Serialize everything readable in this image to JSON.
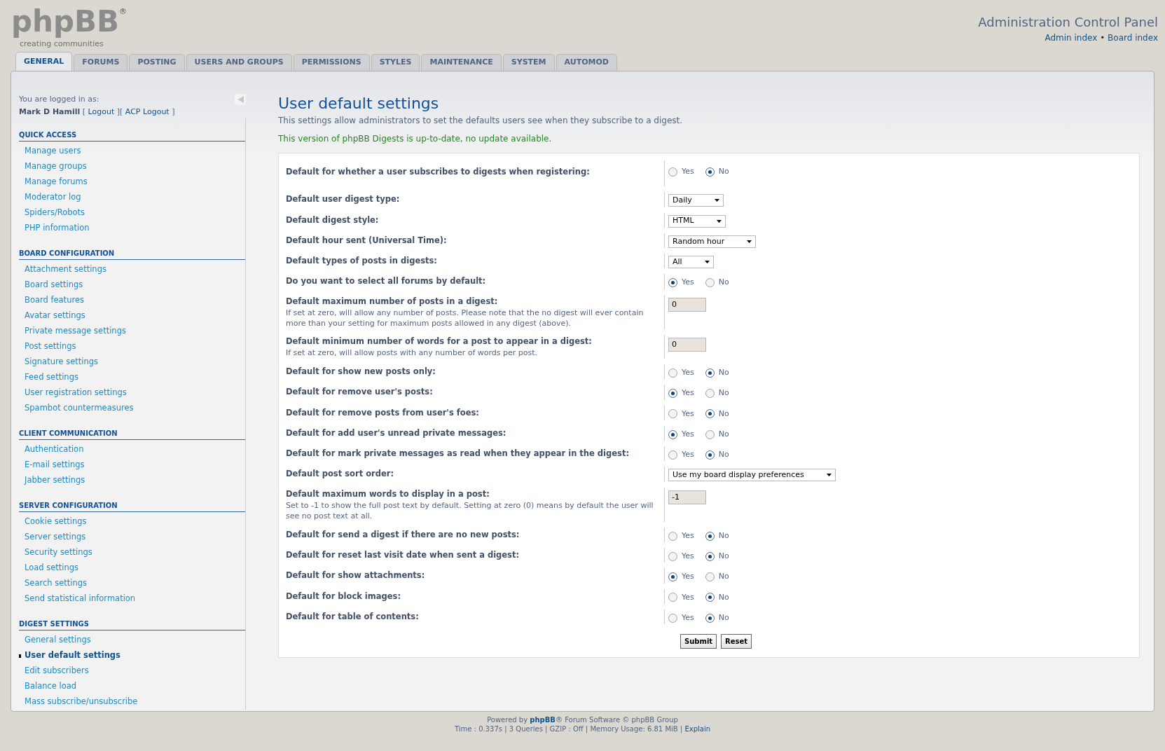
{
  "logo": {
    "text": "phpBB",
    "mark": "®",
    "tagline": "creating communities"
  },
  "header": {
    "title": "Administration Control Panel",
    "links": [
      {
        "kind": "link",
        "text": "Admin index"
      },
      {
        "kind": "text",
        "text": " • "
      },
      {
        "kind": "link",
        "text": "Board index"
      }
    ]
  },
  "tabs": [
    {
      "label": "GENERAL",
      "selected": true
    },
    {
      "label": "FORUMS",
      "selected": false
    },
    {
      "label": "POSTING",
      "selected": false
    },
    {
      "label": "USERS AND GROUPS",
      "selected": false
    },
    {
      "label": "PERMISSIONS",
      "selected": false
    },
    {
      "label": "STYLES",
      "selected": false
    },
    {
      "label": "MAINTENANCE",
      "selected": false
    },
    {
      "label": "SYSTEM",
      "selected": false
    },
    {
      "label": "AUTOMOD",
      "selected": false
    }
  ],
  "sidebar": {
    "login_label": "You are logged in as:",
    "login_line": [
      {
        "kind": "user",
        "text": "Mark D Hamill"
      },
      {
        "kind": "text",
        "text": " [ "
      },
      {
        "kind": "link",
        "text": "Logout"
      },
      {
        "kind": "text",
        "text": " ][ "
      },
      {
        "kind": "link",
        "text": "ACP Logout"
      },
      {
        "kind": "text",
        "text": " ]"
      }
    ],
    "sections": [
      {
        "title": "QUICK ACCESS",
        "items": [
          {
            "label": "Manage users",
            "selected": false
          },
          {
            "label": "Manage groups",
            "selected": false
          },
          {
            "label": "Manage forums",
            "selected": false
          },
          {
            "label": "Moderator log",
            "selected": false
          },
          {
            "label": "Spiders/Robots",
            "selected": false
          },
          {
            "label": "PHP information",
            "selected": false
          }
        ]
      },
      {
        "title": "BOARD CONFIGURATION",
        "items": [
          {
            "label": "Attachment settings",
            "selected": false
          },
          {
            "label": "Board settings",
            "selected": false
          },
          {
            "label": "Board features",
            "selected": false
          },
          {
            "label": "Avatar settings",
            "selected": false
          },
          {
            "label": "Private message settings",
            "selected": false
          },
          {
            "label": "Post settings",
            "selected": false
          },
          {
            "label": "Signature settings",
            "selected": false
          },
          {
            "label": "Feed settings",
            "selected": false
          },
          {
            "label": "User registration settings",
            "selected": false
          },
          {
            "label": "Spambot countermeasures",
            "selected": false
          }
        ]
      },
      {
        "title": "CLIENT COMMUNICATION",
        "items": [
          {
            "label": "Authentication",
            "selected": false
          },
          {
            "label": "E-mail settings",
            "selected": false
          },
          {
            "label": "Jabber settings",
            "selected": false
          }
        ]
      },
      {
        "title": "SERVER CONFIGURATION",
        "items": [
          {
            "label": "Cookie settings",
            "selected": false
          },
          {
            "label": "Server settings",
            "selected": false
          },
          {
            "label": "Security settings",
            "selected": false
          },
          {
            "label": "Load settings",
            "selected": false
          },
          {
            "label": "Search settings",
            "selected": false
          },
          {
            "label": "Send statistical information",
            "selected": false
          }
        ]
      },
      {
        "title": "DIGEST SETTINGS",
        "items": [
          {
            "label": "General settings",
            "selected": false
          },
          {
            "label": "User default settings",
            "selected": true
          },
          {
            "label": "Edit subscribers",
            "selected": false
          },
          {
            "label": "Balance load",
            "selected": false
          },
          {
            "label": "Mass subscribe/unsubscribe",
            "selected": false
          }
        ]
      }
    ]
  },
  "page": {
    "title": "User default settings",
    "description": "This settings allow administrators to set the defaults users see when they subscribe to a digest.",
    "notice": "This version of phpBB Digests is up-to-date, no update available."
  },
  "form": {
    "rows": [
      {
        "kind": "radio",
        "label": "Default for whether a user subscribes to digests when registering:",
        "options": [
          {
            "label": "Yes",
            "selected": false
          },
          {
            "label": "No",
            "selected": true
          }
        ]
      },
      {
        "kind": "select",
        "label": "Default user digest type:",
        "value": "Daily"
      },
      {
        "kind": "select",
        "label": "Default digest style:",
        "value": "HTML"
      },
      {
        "kind": "select",
        "label": "Default hour sent (Universal Time):",
        "value": "Random hour"
      },
      {
        "kind": "select",
        "label": "Default types of posts in digests:",
        "value": "All"
      },
      {
        "kind": "radio",
        "label": "Do you want to select all forums by default:",
        "options": [
          {
            "label": "Yes",
            "selected": true
          },
          {
            "label": "No",
            "selected": false
          }
        ]
      },
      {
        "kind": "input",
        "label": "Default maximum number of posts in a digest:",
        "description": "If set at zero, will allow any number of posts. Please note that the no digest will ever contain more than your setting for maximum posts allowed in any digest (above).",
        "value": "0"
      },
      {
        "kind": "input",
        "label": "Default minimum number of words for a post to appear in a digest:",
        "description": "If set at zero, will allow posts with any number of words per post.",
        "value": "0"
      },
      {
        "kind": "radio",
        "label": "Default for show new posts only:",
        "options": [
          {
            "label": "Yes",
            "selected": false
          },
          {
            "label": "No",
            "selected": true
          }
        ]
      },
      {
        "kind": "radio",
        "label": "Default for remove user's posts:",
        "options": [
          {
            "label": "Yes",
            "selected": true
          },
          {
            "label": "No",
            "selected": false
          }
        ]
      },
      {
        "kind": "radio",
        "label": "Default for remove posts from user's foes:",
        "options": [
          {
            "label": "Yes",
            "selected": false
          },
          {
            "label": "No",
            "selected": true
          }
        ]
      },
      {
        "kind": "radio",
        "label": "Default for add user's unread private messages:",
        "options": [
          {
            "label": "Yes",
            "selected": true
          },
          {
            "label": "No",
            "selected": false
          }
        ]
      },
      {
        "kind": "radio",
        "label": "Default for mark private messages as read when they appear in the digest:",
        "options": [
          {
            "label": "Yes",
            "selected": false
          },
          {
            "label": "No",
            "selected": true
          }
        ]
      },
      {
        "kind": "select",
        "label": "Default post sort order:",
        "value": "Use my board display preferences"
      },
      {
        "kind": "input",
        "label": "Default maximum words to display in a post:",
        "description": "Set to -1 to show the full post text by default. Setting at zero (0) means by default the user will see no post text at all.",
        "value": "-1"
      },
      {
        "kind": "radio",
        "label": "Default for send a digest if there are no new posts:",
        "options": [
          {
            "label": "Yes",
            "selected": false
          },
          {
            "label": "No",
            "selected": true
          }
        ]
      },
      {
        "kind": "radio",
        "label": "Default for reset last visit date when sent a digest:",
        "options": [
          {
            "label": "Yes",
            "selected": false
          },
          {
            "label": "No",
            "selected": true
          }
        ]
      },
      {
        "kind": "radio",
        "label": "Default for show attachments:",
        "options": [
          {
            "label": "Yes",
            "selected": true
          },
          {
            "label": "No",
            "selected": false
          }
        ]
      },
      {
        "kind": "radio",
        "label": "Default for block images:",
        "options": [
          {
            "label": "Yes",
            "selected": false
          },
          {
            "label": "No",
            "selected": true
          }
        ]
      },
      {
        "kind": "radio",
        "label": "Default for table of contents:",
        "options": [
          {
            "label": "Yes",
            "selected": false
          },
          {
            "label": "No",
            "selected": true
          }
        ]
      }
    ],
    "buttons": [
      "Submit",
      "Reset"
    ]
  },
  "footer": {
    "lines": [
      [
        {
          "kind": "text",
          "text": "Powered by "
        },
        {
          "kind": "brand",
          "text": "phpBB"
        },
        {
          "kind": "text",
          "text": "® Forum Software © phpBB Group"
        }
      ],
      [
        {
          "kind": "text",
          "text": "Time : 0.337s | 3 Queries | GZIP : Off | Memory Usage: 6.81 MiB | "
        },
        {
          "kind": "link",
          "text": "Explain"
        }
      ]
    ]
  }
}
